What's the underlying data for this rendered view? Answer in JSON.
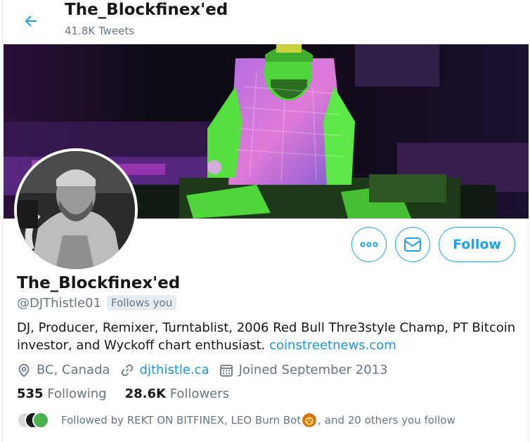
{
  "header": {
    "title": "The_Blockfinex'ed",
    "tweet_count": "41.8K Tweets"
  },
  "profile": {
    "display_name": "The_Blockfinex'ed",
    "handle": "@DJThistle01",
    "follows_you": "Follows you",
    "bio_text": "DJ, Producer, Remixer, Turntablist, 2006 Red Bull Thre3style Champ, PT Bitcoin investor, and Wyckoff chart enthusiast. ",
    "bio_link": "coinstreetnews.com",
    "location": "BC, Canada",
    "website": "djthistle.ca",
    "joined": "Joined September 2013"
  },
  "counts": {
    "following_value": "535",
    "following_label": "Following",
    "followers_value": "28.6K",
    "followers_label": "Followers"
  },
  "followed_by": {
    "prefix": "Followed by REKT ON BITFINEX, LEO Burn Bot",
    "suffix": ", and 20 others you follow"
  },
  "actions": {
    "follow_label": "Follow"
  },
  "colors": {
    "accent": "#1da1f2",
    "link": "#1b95e0",
    "muted": "#657786",
    "text": "#14171a"
  },
  "icons": [
    "back-arrow-icon",
    "more-icon",
    "envelope-icon",
    "location-pin-icon",
    "link-icon",
    "calendar-icon",
    "lion-emoji-icon"
  ]
}
